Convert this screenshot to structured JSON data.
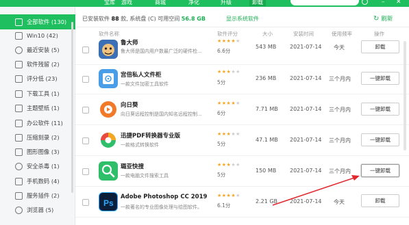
{
  "nav": {
    "tabs": [
      {
        "label": "宝库"
      },
      {
        "label": "游戏"
      },
      {
        "label": "商城"
      },
      {
        "label": "净化"
      },
      {
        "label": "升级"
      },
      {
        "label": "卸载"
      }
    ]
  },
  "sidebar": {
    "items": [
      {
        "label": "全部软件 (130)",
        "icon": "grid-icon"
      },
      {
        "label": "Win10 (42)",
        "icon": "window-icon"
      },
      {
        "label": "最近安装 (5)",
        "icon": "clock-icon"
      },
      {
        "label": "软件残留 (2)",
        "icon": "broom-icon"
      },
      {
        "label": "评分低 (23)",
        "icon": "star-icon"
      },
      {
        "label": "下载工具 (1)",
        "icon": "download-icon"
      },
      {
        "label": "主题壁纸 (1)",
        "icon": "theme-icon"
      },
      {
        "label": "办公软件 (11)",
        "icon": "office-icon"
      },
      {
        "label": "压缩刻录 (2)",
        "icon": "archive-icon"
      },
      {
        "label": "图形图像 (3)",
        "icon": "image-icon"
      },
      {
        "label": "安全杀毒 (1)",
        "icon": "shield-icon"
      },
      {
        "label": "手机数码 (4)",
        "icon": "phone-icon"
      },
      {
        "label": "服务插件 (2)",
        "icon": "plugin-icon"
      },
      {
        "label": "浏览器 (5)",
        "icon": "browser-icon"
      }
    ]
  },
  "toolbar": {
    "installed_prefix": "已安装软件",
    "installed_count": "88",
    "installed_suffix": "款, 系统盘 (C) 可用空间",
    "disk_free": "56.8 GB",
    "show_system": "显示系统软件",
    "refresh": "刷新"
  },
  "table": {
    "headers": {
      "name": "软件名称",
      "score": "软件评分",
      "size": "大小",
      "date": "安装时间",
      "freq": "使用频率",
      "action": "操作"
    },
    "rows": [
      {
        "name": "鲁大师",
        "desc": "鲁大师是国内用户数最广泛的硬件检...",
        "stars": 4,
        "score": "6.6分",
        "size": "543 MB",
        "date": "2021-07-14",
        "freq": "今天",
        "action": "卸载",
        "icon_color": "#3b6fb6"
      },
      {
        "name": "宫倍私人文件柜",
        "desc": "一款文件加密工具软件",
        "stars": 3,
        "score": "5分",
        "size": "236 MB",
        "date": "2021-07-14",
        "freq": "三个月内",
        "action": "一键卸载",
        "icon_color": "#4a9ee8"
      },
      {
        "name": "向日葵",
        "desc": "向日葵远程控制是国内知名远程控制...",
        "stars": 4,
        "score": "6分",
        "size": "7.71 MB",
        "date": "2021-07-14",
        "freq": "三个月内",
        "action": "一键卸载",
        "icon_color": "#f07a2a"
      },
      {
        "name": "迅捷PDF转换器专业版",
        "desc": "一款格式转换软件",
        "stars": 3,
        "score": "5分",
        "size": "47.1 MB",
        "date": "2021-07-14",
        "freq": "三个月内",
        "action": "一键卸载",
        "icon_color": "#ffffff"
      },
      {
        "name": "璐亚快搜",
        "desc": "一款电脑文件搜索工具",
        "stars": 3,
        "score": "5分",
        "size": "150 MB",
        "date": "2021-07-14",
        "freq": "三个月内",
        "action": "一键卸载",
        "icon_color": "#2fbf6a"
      },
      {
        "name": "Adobe Photoshop CC 2019",
        "desc": "一款著名的专业图像处理与绘图软件。",
        "stars": 4,
        "score": "6.1分",
        "size": "2.21 GB",
        "date": "2021-07-14",
        "freq": "今天",
        "action": "卸载",
        "icon_color": "#0b1f3a"
      }
    ]
  }
}
